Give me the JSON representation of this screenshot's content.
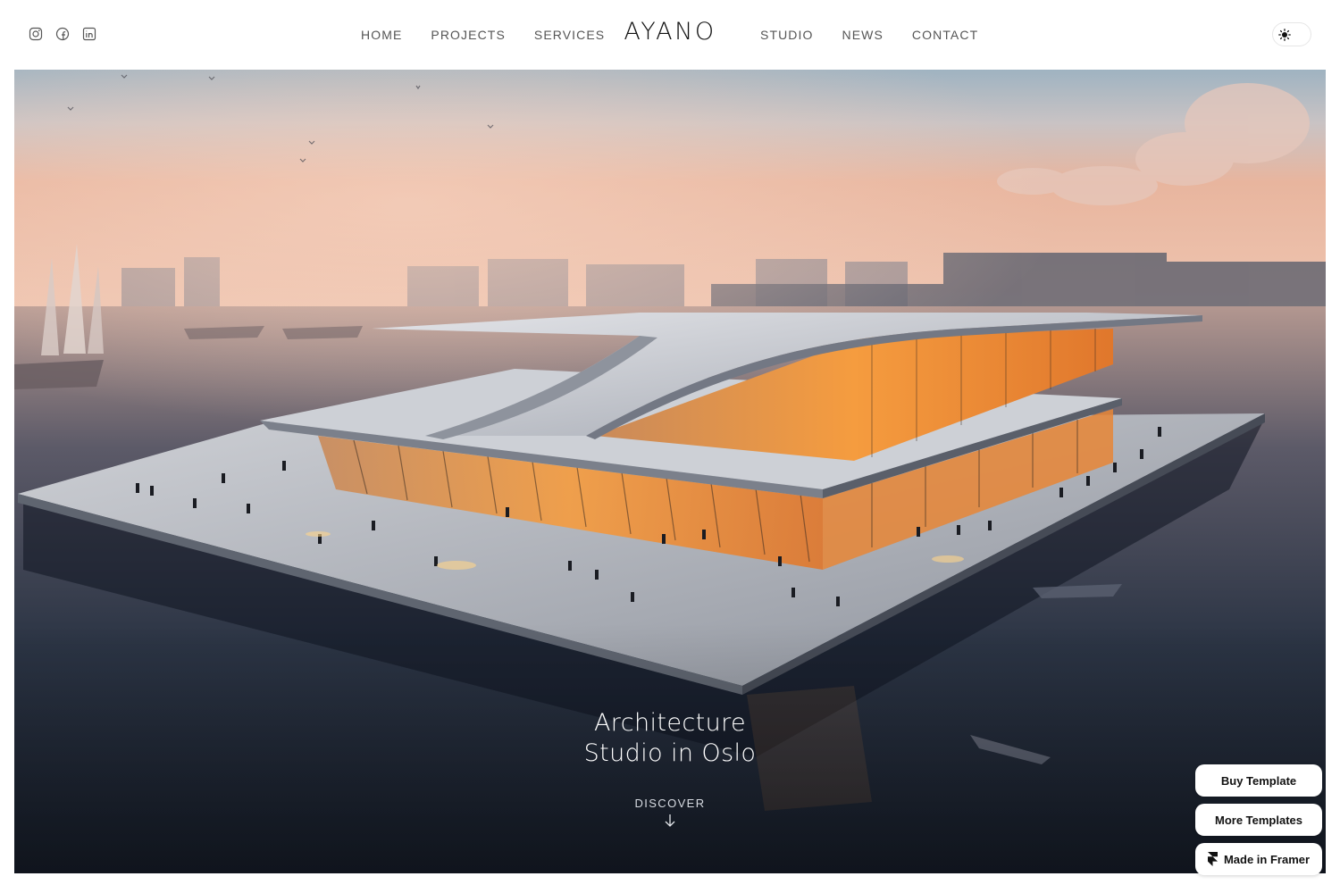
{
  "header": {
    "social": [
      {
        "icon": "instagram-icon"
      },
      {
        "icon": "facebook-icon"
      },
      {
        "icon": "linkedin-icon"
      }
    ],
    "nav_left": [
      "HOME",
      "PROJECTS",
      "SERVICES"
    ],
    "logo": "AYANO",
    "nav_right": [
      "STUDIO",
      "NEWS",
      "CONTACT"
    ],
    "theme_toggle": {
      "icon": "sun-icon"
    }
  },
  "hero": {
    "title_line1": "Architecture",
    "title_line2": "Studio in Oslo",
    "discover_label": "DISCOVER",
    "discover_icon": "arrow-down-icon"
  },
  "floating": {
    "buy_label": "Buy Template",
    "more_label": "More Templates",
    "framer_label": "Made in Framer",
    "framer_icon": "framer-icon"
  },
  "colors": {
    "background": "#ffffff",
    "nav_text": "#555555",
    "hero_text": "#ffffff",
    "sky_top": "#9fb3c1",
    "sky_glow": "#e8b59e",
    "water": "#1f2838",
    "interior_glow": "#f39a45"
  }
}
